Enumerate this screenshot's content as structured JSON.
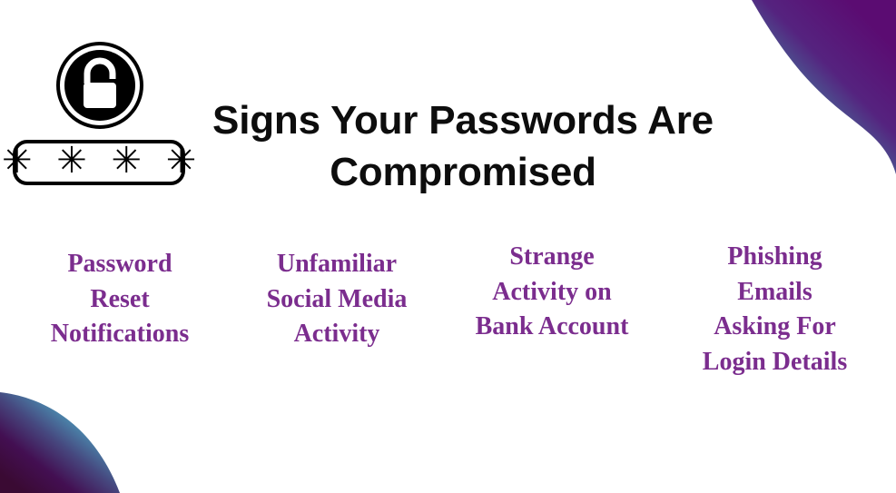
{
  "slide": {
    "background_color": "#ffffff",
    "title": "Signs Your Passwords Are Compromised",
    "title_color": "#0d0d0d"
  },
  "brand_mark": {
    "lock_icon_name": "padlock-icon",
    "password_dots": "✳ ✳ ✳ ✳",
    "password_dot_count": 4,
    "mark_color": "#000000"
  },
  "signs": {
    "accent_color": "#7b2d8e",
    "items": [
      {
        "text": "Password\nReset\nNotifications"
      },
      {
        "text": "Unfamiliar\nSocial Media\nActivity"
      },
      {
        "text": "Strange\nActivity on\nBank Account"
      },
      {
        "text": "Phishing\nEmails\nAsking For\nLogin Details"
      }
    ]
  },
  "decor": {
    "blob_top_right": {
      "name": "top-right-gradient-blob",
      "teal": "#3a9cb5",
      "purple": "#5b0c72"
    },
    "blob_bottom_left": {
      "name": "bottom-left-gradient-blob",
      "teal": "#4b9dba",
      "purple": "#4a0d55",
      "maroon": "#3a0a33"
    }
  }
}
